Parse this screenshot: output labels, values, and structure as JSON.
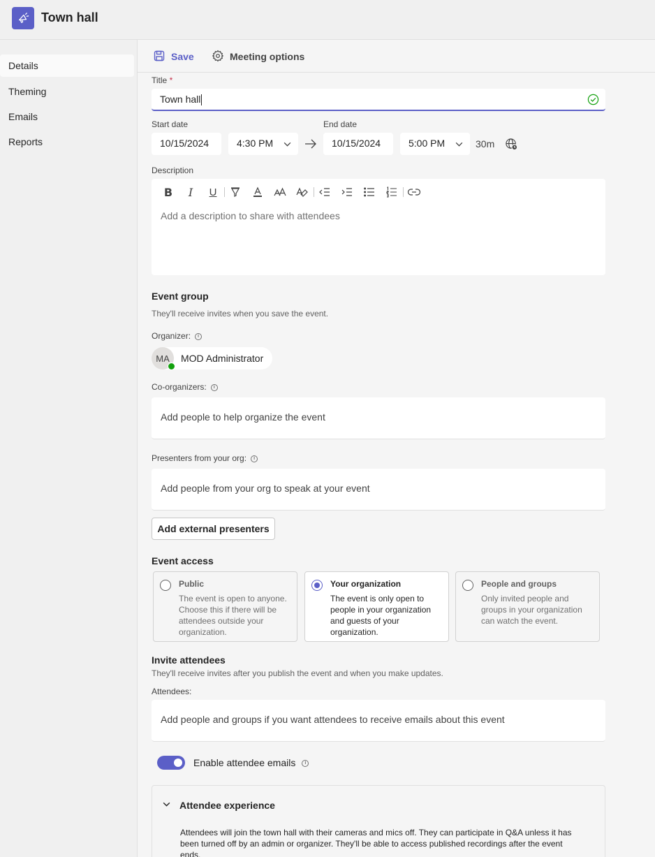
{
  "app": {
    "title": "Town hall"
  },
  "sidebar": {
    "items": [
      {
        "label": "Details"
      },
      {
        "label": "Theming"
      },
      {
        "label": "Emails"
      },
      {
        "label": "Reports"
      }
    ]
  },
  "toolbar": {
    "save_label": "Save",
    "options_label": "Meeting options"
  },
  "form": {
    "title_label": "Title",
    "required_mark": "*",
    "title_value": "Town hall",
    "start_date_label": "Start date",
    "start_date": "10/15/2024",
    "start_time": "4:30 PM",
    "end_date_label": "End date",
    "end_date": "10/15/2024",
    "end_time": "5:00 PM",
    "duration": "30m",
    "description_label": "Description",
    "description_placeholder": "Add a description to share with attendees"
  },
  "event_group": {
    "title": "Event group",
    "subtitle": "They'll receive invites when you save the event.",
    "organizer_label": "Organizer:",
    "organizer_initials": "MA",
    "organizer_name": "MOD Administrator",
    "coorganizers_label": "Co-organizers:",
    "coorganizers_placeholder": "Add people to help organize the event",
    "presenters_label": "Presenters from your org:",
    "presenters_placeholder": "Add people from your org to speak at your event",
    "external_button": "Add external presenters"
  },
  "event_access": {
    "title": "Event access",
    "options": [
      {
        "title": "Public",
        "desc": "The event is open to anyone. Choose this if there will be attendees outside your organization.",
        "selected": false
      },
      {
        "title": "Your organization",
        "desc": "The event is only open to people in your organization and guests of your organization.",
        "selected": true
      },
      {
        "title": "People and groups",
        "desc": "Only invited people and groups in your organization can watch the event.",
        "selected": false
      }
    ]
  },
  "invite": {
    "title": "Invite attendees",
    "subtitle": "They'll receive invites after you publish the event and when you make updates.",
    "attendees_label": "Attendees:",
    "attendees_placeholder": "Add people and groups if you want attendees to receive emails about this event",
    "toggle_label": "Enable attendee emails",
    "toggle_on": true
  },
  "experience": {
    "title": "Attendee experience",
    "text": "Attendees will join the town hall with their cameras and mics off. They can participate in Q&A unless it has been turned off by an admin or organizer. They'll be able to access published recordings after the event ends."
  },
  "colors": {
    "accent": "#5b5fc7",
    "success": "#13a10e",
    "required": "#c4314b"
  },
  "icons": [
    "town-hall-icon",
    "save-icon",
    "gear-icon",
    "checkmark-circle-icon",
    "chevron-down-icon",
    "arrow-right-icon",
    "globe-clock-icon",
    "bold-icon",
    "italic-icon",
    "underline-icon",
    "highlight-icon",
    "font-color-icon",
    "font-size-icon",
    "clear-format-icon",
    "decrease-indent-icon",
    "increase-indent-icon",
    "bulleted-list-icon",
    "numbered-list-icon",
    "link-icon",
    "info-icon"
  ]
}
